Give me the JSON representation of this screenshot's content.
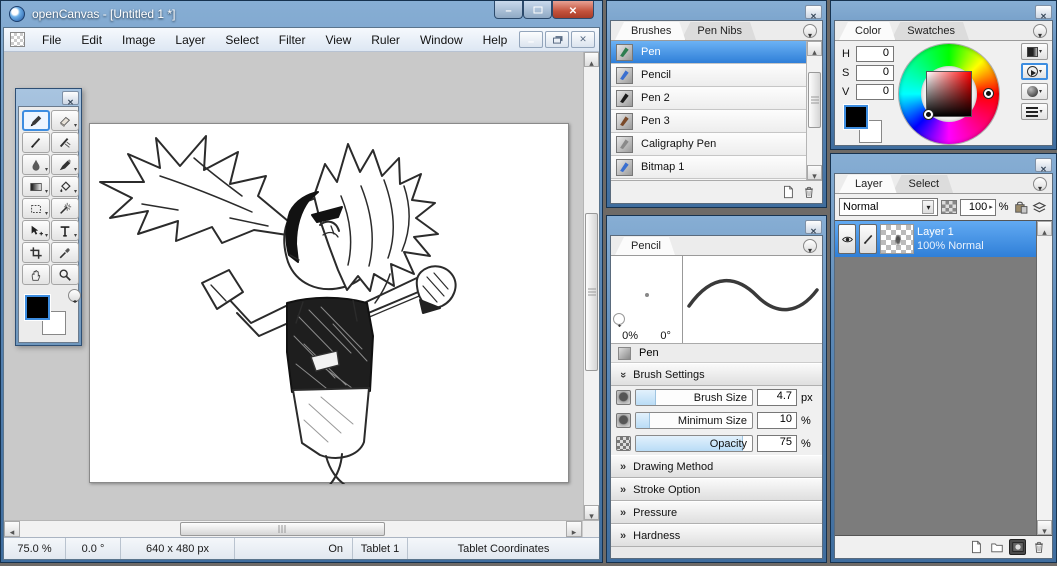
{
  "app": {
    "title": "openCanvas - [Untitled 1 *]",
    "menus": [
      "File",
      "Edit",
      "Image",
      "Layer",
      "Select",
      "Filter",
      "View",
      "Ruler",
      "Window",
      "Help"
    ]
  },
  "toolbox": {
    "selected_tool": "Pen",
    "tools": [
      "Pen",
      "Eraser",
      "Pencil",
      "Marker Pen",
      "Blur",
      "Brush",
      "Gradient",
      "Bucket Fill",
      "Selection",
      "Magic Wand",
      "Move",
      "Text",
      "Crop",
      "Eyedropper",
      "Hand",
      "Zoom"
    ],
    "foreground_color": "#000000",
    "background_color": "#ffffff"
  },
  "statusbar": {
    "zoom_level": "75.0 %",
    "rotation": "0.0 °",
    "canvas_size": "640 x 480 px",
    "tablet_status": "On",
    "tablet_name": "Tablet 1",
    "tablet_mode": "Tablet Coordinates"
  },
  "brushes_panel": {
    "tabs": [
      "Brushes",
      "Pen Nibs"
    ],
    "selected_item": "Pen",
    "items": [
      {
        "label": "Pen",
        "color": "#2e7d4f"
      },
      {
        "label": "Pencil",
        "color": "#3a6fd0"
      },
      {
        "label": "Pen 2",
        "color": "#1a1a1a"
      },
      {
        "label": "Pen 3",
        "color": "#7a4a2a"
      },
      {
        "label": "Caligraphy Pen",
        "color": "#8a8a8a"
      },
      {
        "label": "Bitmap 1",
        "color": "#3a6fd0"
      }
    ]
  },
  "pencil_panel": {
    "tab": "Pencil",
    "preview_percent": "0%",
    "preview_angle": "0°",
    "brush_name": "Pen",
    "brush_settings_label": "Brush Settings",
    "sliders": [
      {
        "label": "Brush Size",
        "value": "4.7",
        "unit": "px",
        "fill": 17
      },
      {
        "label": "Minimum Size",
        "value": "10",
        "unit": "%",
        "fill": 12
      },
      {
        "label": "Opacity",
        "value": "75",
        "unit": "%",
        "fill": 92
      }
    ],
    "collapsed_sections": [
      "Drawing Method",
      "Stroke Option",
      "Pressure",
      "Hardness"
    ]
  },
  "color_panel": {
    "tabs": [
      "Color",
      "Swatches"
    ],
    "fields": [
      {
        "label": "H",
        "value": "0"
      },
      {
        "label": "S",
        "value": "0"
      },
      {
        "label": "V",
        "value": "0"
      }
    ]
  },
  "layer_panel": {
    "tabs": [
      "Layer",
      "Select"
    ],
    "blend_mode": "Normal",
    "opacity_value": "100",
    "opacity_unit": "%",
    "layers": [
      {
        "name": "Layer 1",
        "info": "100% Normal"
      }
    ]
  }
}
